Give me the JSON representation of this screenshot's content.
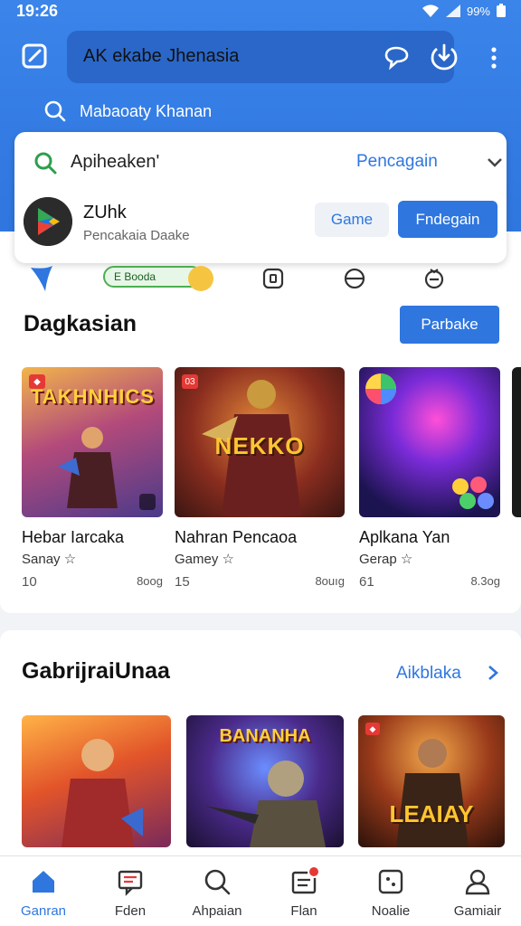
{
  "status_bar": {
    "time": "19:26",
    "battery_text": "99%"
  },
  "header": {
    "search_text": "AK ekabe Jhenasia",
    "sub_search_text": "Mabaoaty Khanan"
  },
  "suggestion": {
    "query": "Apiheaken'",
    "link_label": "Pencagain",
    "app_name": "ZUhk",
    "app_subtitle": "Pencakaia Daake",
    "game_button": "Game",
    "install_button": "Fndegain"
  },
  "chips": {
    "pill_label": "E Booda"
  },
  "section1": {
    "title": "Dagkasian",
    "button": "Parbake",
    "games": [
      {
        "art": "TAKHNHICS",
        "title": "Hebar Iarcaka",
        "genre": "Sanay ☆",
        "count": "10",
        "size": "8oog"
      },
      {
        "art": "NEKKO",
        "title": "Nahran Pencaoa",
        "genre": "Gamey ☆",
        "count": "15",
        "size": "8ouıg"
      },
      {
        "art": "",
        "title": "Aplkana Yan",
        "genre": "Gerap ☆",
        "count": "61",
        "size": "8.3og"
      }
    ]
  },
  "section2": {
    "title": "GabrijraiUnaa",
    "link": "Aikblaka",
    "tiles": [
      {
        "art": ""
      },
      {
        "art": "BANANHA"
      },
      {
        "art": "LEAIAY"
      }
    ]
  },
  "bottom_nav": [
    {
      "label": "Ganran",
      "icon": "home-icon"
    },
    {
      "label": "Fden",
      "icon": "message-icon"
    },
    {
      "label": "Ahpaian",
      "icon": "search-icon"
    },
    {
      "label": "Flan",
      "icon": "inbox-icon"
    },
    {
      "label": "Noalie",
      "icon": "apps-icon"
    },
    {
      "label": "Gamiair",
      "icon": "profile-icon"
    }
  ],
  "colors": {
    "primary": "#2f76df",
    "header": "#3a84ea",
    "badge": "#e53935"
  }
}
